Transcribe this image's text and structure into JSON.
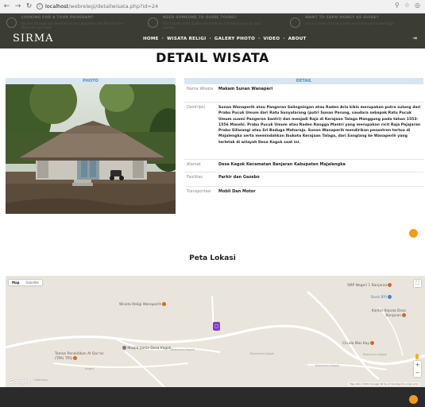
{
  "browser": {
    "url_host": "localhost",
    "url_path": "/webrelegi/detailwisata.php?id=24"
  },
  "promos": [
    {
      "title": "LOOKING FOR A TOUR PROGRAM?",
      "text": "Browse through our selection of tour programs and find the one that suits you best."
    },
    {
      "title": "NEED SOMEONE TO GUIDE TOURS?",
      "text": "Our friendly local guides are ready to accompany you on your journey."
    },
    {
      "title": "WANT TO EARN MONEY AS GUIDE?",
      "text": "Join our team of local guides and share your knowledge."
    }
  ],
  "site": {
    "brand": "SIRMA",
    "nav": [
      "HOME",
      "WISATA RELIGI",
      "GALERY PHOTO",
      "VIDEO",
      "ABOUT"
    ],
    "nav_sep": "·"
  },
  "page": {
    "title": "DETAIL WISATA",
    "photo_header": "PHOTO",
    "detail_header": "DETAIL",
    "rows": [
      {
        "label": "Nama Wisata",
        "value": "Makam Sunan Wanaperi"
      },
      {
        "label": "Deskripsi",
        "value": "Sunan Wanaperih atau Pangeran Salingsingan atau Raden Aria kikis merupakan putra sulung dari Prabu Pucuk Umum dari Ratu Sunyalarang (putri Sunan Parung, saudara sebapak Ratu Pucuk Umum suami Pangeran Santri) dan menjadi Raja di Kerajaan Talaga Manggung pada tahun 1553-1556 Masehi. Prabu Pucuk Umum atau Raden Rangga Mantri yang merupakan cicit Raja Pajajaran Prabu Siliwangi atau Sri Baduga Maharaja. Sunan Wanaperih mendirikan pesantren tertua di Majalengka serta memindahkan Ibukota Kerajaan Talaga, dari Sanglang ke Wanaperih yang terletak di wilayah Desa Kagok saat ini."
      },
      {
        "label": "Alamat",
        "value": "Desa Kagok Kecamatan Banjaran Kabupaten Majalengka"
      },
      {
        "label": "Fasilitas",
        "value": "Parkir dan Gazebo"
      },
      {
        "label": "Transportasi",
        "value": "Mobil Dan Motor"
      }
    ],
    "map_title": "Peta Lokasi"
  },
  "map": {
    "type_map": "Map",
    "type_sat": "Satellite",
    "places": [
      {
        "name": "Wisata Religi Wanaperih",
        "style": "poi"
      },
      {
        "name": "SMP Negeri 1 Banjaran",
        "style": "poi"
      },
      {
        "name": "Bank BRI",
        "style": "blue"
      },
      {
        "name": "Kantor Kepala Desa Banjaran",
        "style": "poi"
      },
      {
        "name": "Masjid Jamie Desa Kagok",
        "style": "gray"
      },
      {
        "name": "Ciruda Mas Kay",
        "style": "poi"
      },
      {
        "name": "Taman Pendidikan Al-Qur'an (TPA) TPQ",
        "style": "poi"
      }
    ],
    "roads": [
      "Banjaran-Kagok",
      "Banjaran-Kagok",
      "Kagok",
      "Banjaran-Kagok",
      "Banjaran-Kagok",
      "Cikoneng"
    ],
    "logo": "Google",
    "attribution": "Map data ©2019 Google   Terms of Use   Report a map error",
    "zoom_in": "+",
    "zoom_out": "−"
  }
}
